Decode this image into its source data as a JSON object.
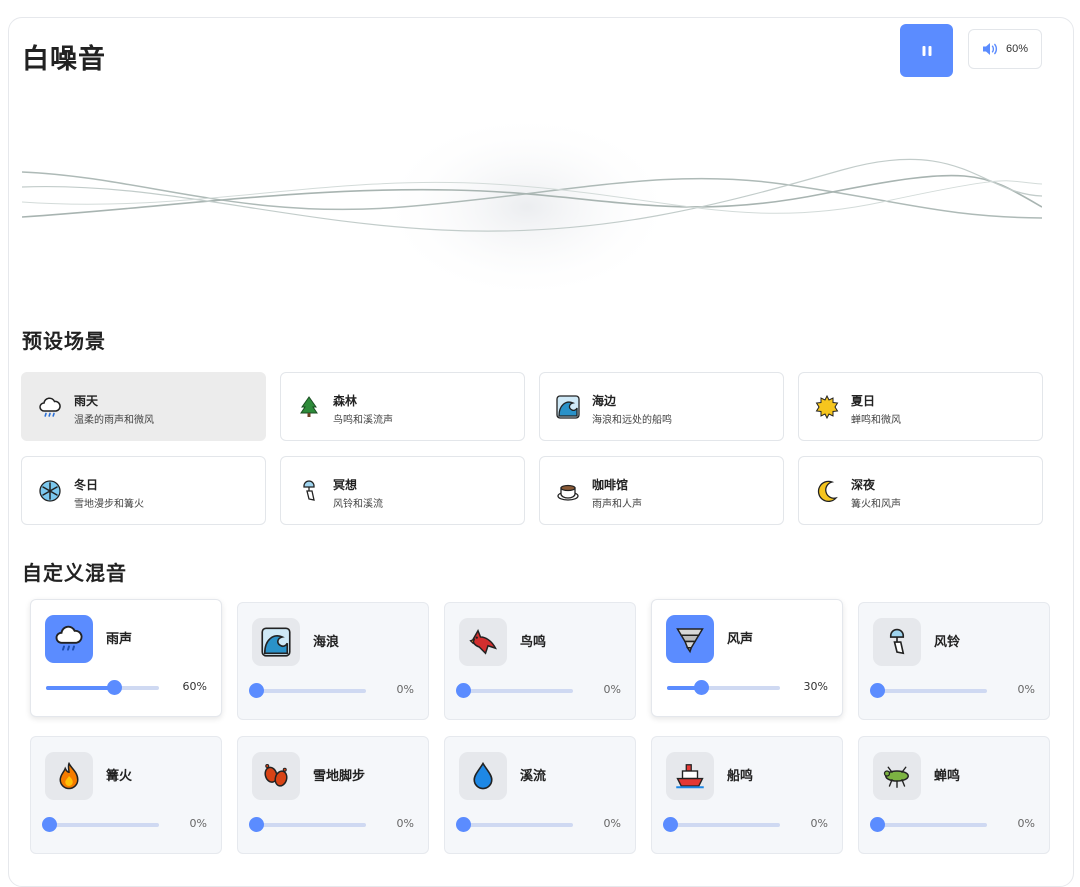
{
  "header": {
    "title": "白噪音",
    "play_state_icon": "pause-icon",
    "volume_icon": "speaker-icon",
    "volume_label": "60%"
  },
  "colors": {
    "accent": "#5b8cff",
    "track": "#cfd9f2",
    "active_preset_bg": "#ececec",
    "card_bg": "#f5f7fa"
  },
  "presets": {
    "title": "预设场景",
    "items": [
      {
        "name": "雨天",
        "desc": "温柔的雨声和微风",
        "icon": "cloud-rain-icon",
        "active": true
      },
      {
        "name": "森林",
        "desc": "鸟鸣和溪流声",
        "icon": "evergreen-tree-icon",
        "active": false
      },
      {
        "name": "海边",
        "desc": "海浪和远处的船鸣",
        "icon": "ocean-wave-icon",
        "active": false
      },
      {
        "name": "夏日",
        "desc": "蝉鸣和微风",
        "icon": "sun-icon",
        "active": false
      },
      {
        "name": "冬日",
        "desc": "雪地漫步和篝火",
        "icon": "snowflake-icon",
        "active": false
      },
      {
        "name": "冥想",
        "desc": "风铃和溪流",
        "icon": "wind-chime-icon",
        "active": false
      },
      {
        "name": "咖啡馆",
        "desc": "雨声和人声",
        "icon": "coffee-cup-icon",
        "active": false
      },
      {
        "name": "深夜",
        "desc": "篝火和风声",
        "icon": "crescent-moon-icon",
        "active": false
      }
    ]
  },
  "mixer": {
    "title": "自定义混音",
    "sounds": [
      {
        "name": "雨声",
        "value": 60,
        "label": "60%",
        "icon": "cloud-rain-icon",
        "active": true
      },
      {
        "name": "海浪",
        "value": 0,
        "label": "0%",
        "icon": "ocean-wave-icon",
        "active": false
      },
      {
        "name": "鸟鸣",
        "value": 0,
        "label": "0%",
        "icon": "cardinal-bird-icon",
        "active": false
      },
      {
        "name": "风声",
        "value": 30,
        "label": "30%",
        "icon": "tornado-icon",
        "active": true
      },
      {
        "name": "风铃",
        "value": 0,
        "label": "0%",
        "icon": "wind-chime-icon",
        "active": false
      },
      {
        "name": "篝火",
        "value": 0,
        "label": "0%",
        "icon": "fire-icon",
        "active": false
      },
      {
        "name": "雪地脚步",
        "value": 0,
        "label": "0%",
        "icon": "footprints-icon",
        "active": false
      },
      {
        "name": "溪流",
        "value": 0,
        "label": "0%",
        "icon": "water-drop-icon",
        "active": false
      },
      {
        "name": "船鸣",
        "value": 0,
        "label": "0%",
        "icon": "ship-icon",
        "active": false
      },
      {
        "name": "蝉鸣",
        "value": 0,
        "label": "0%",
        "icon": "cicada-icon",
        "active": false
      }
    ]
  }
}
